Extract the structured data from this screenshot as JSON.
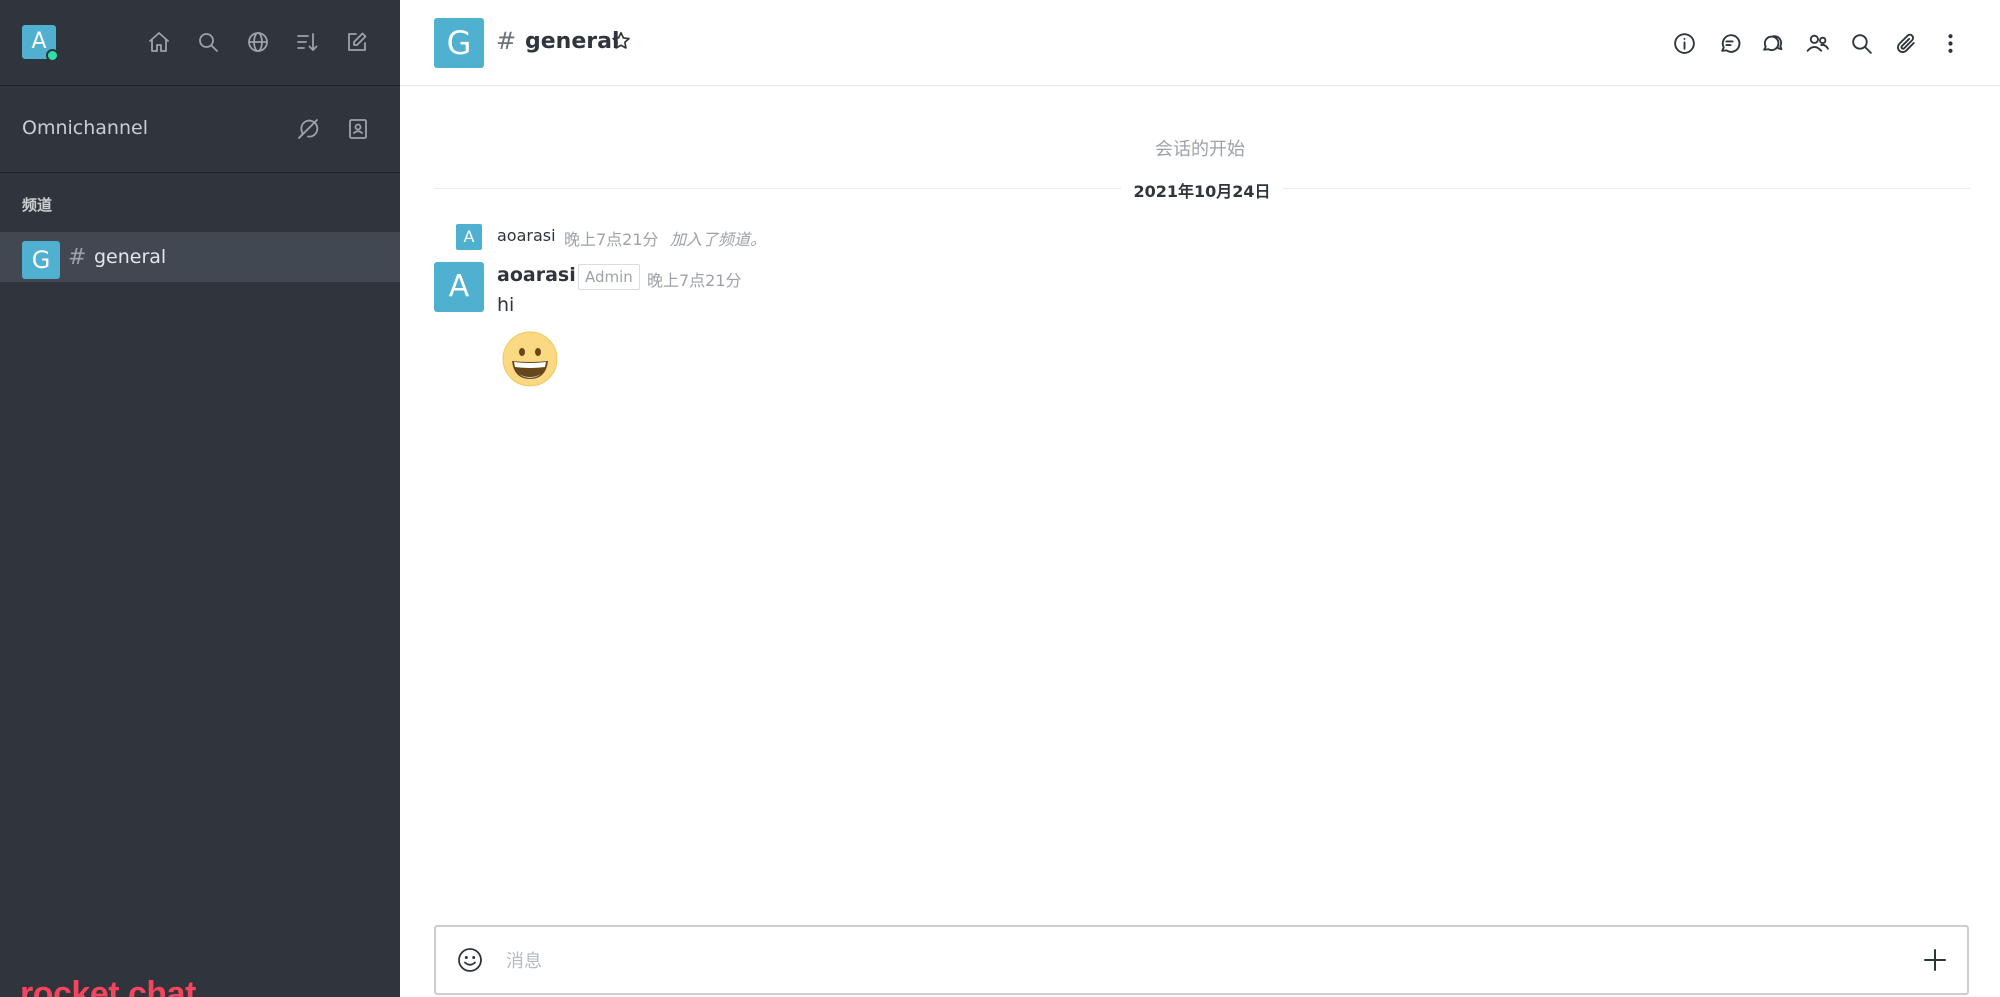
{
  "sidebar": {
    "user": {
      "initial": "A",
      "status": "online"
    },
    "toolbar_icons": [
      "home-icon",
      "search-icon",
      "globe-icon",
      "sort-icon",
      "create-new-icon"
    ],
    "omnichannel": {
      "title": "Omnichannel",
      "icons": [
        "omnichannel-offline-icon",
        "contact-center-icon"
      ]
    },
    "section_title": "频道",
    "rooms": [
      {
        "initial": "G",
        "hash": "#",
        "name": "general",
        "selected": true
      }
    ],
    "brand": "rocket.chat"
  },
  "header": {
    "initial": "G",
    "hash": "#",
    "room_name": "general",
    "icons": [
      "info-icon",
      "discussion-icon",
      "threads-icon",
      "members-icon",
      "search-icon",
      "attachment-icon",
      "kebab-menu-icon"
    ]
  },
  "messages": {
    "conversation_start": "会话的开始",
    "date": "2021年10月24日",
    "system": {
      "initial": "A",
      "user": "aoarasi",
      "time": "晚上7点21分",
      "text": "加入了频道。"
    },
    "message": {
      "initial": "A",
      "user": "aoarasi",
      "role": "Admin",
      "time": "晚上7点21分",
      "text": "hi",
      "emoji": "grinning-face"
    }
  },
  "composer": {
    "placeholder": "消息"
  },
  "colors": {
    "sidebar_bg": "#2f343d",
    "selected_room_bg": "#414852",
    "avatar": "#4fb0cf",
    "brand": "#f5455c",
    "status_online": "#2de0a5"
  }
}
